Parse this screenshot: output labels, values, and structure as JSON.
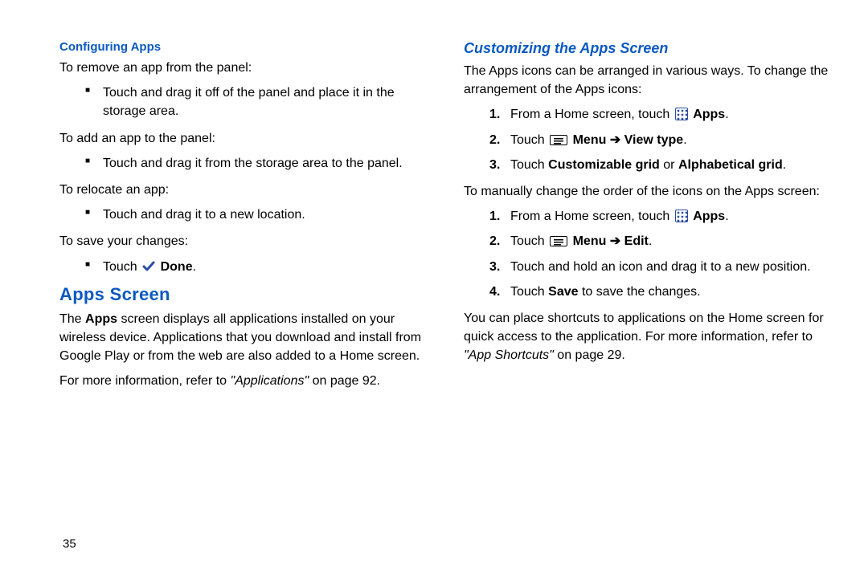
{
  "left": {
    "h_config": "Configuring Apps",
    "remove_intro": "To remove an app from the panel:",
    "remove_b1": "Touch and drag it off of the panel and place it in the storage area.",
    "add_intro": "To add an app to the panel:",
    "add_b1": "Touch and drag it from the storage area to the panel.",
    "relocate_intro": "To relocate an app:",
    "relocate_b1": "Touch and drag it to a new location.",
    "save_intro": "To save your changes:",
    "save_touch": "Touch ",
    "save_done": " Done",
    "h_apps": "Apps Screen",
    "apps_p1a": "The ",
    "apps_p1b": "Apps",
    "apps_p1c": " screen displays all applications installed on your wireless device. Applications that you download and install from Google Play or from the web are also added to a Home screen.",
    "apps_p2a": "For more information, refer to ",
    "apps_p2b": "\"Applications\"",
    "apps_p2c": " on page 92."
  },
  "right": {
    "h_custom": "Customizing the Apps Screen",
    "intro": "The Apps icons can be arranged in various ways. To change the arrangement of the Apps icons:",
    "s1_a": "From a Home screen, touch ",
    "s1_b": " Apps",
    "s1_c": ".",
    "s2_a": "Touch ",
    "s2_b": " Menu ➔ View type",
    "s2_c": ".",
    "s3_a": "Touch ",
    "s3_b": "Customizable grid",
    "s3_c": " or ",
    "s3_d": "Alphabetical grid",
    "s3_e": ".",
    "mid": "To manually change the order of the icons on the Apps screen:",
    "m1_a": "From a Home screen, touch ",
    "m1_b": " Apps",
    "m1_c": ".",
    "m2_a": "Touch ",
    "m2_b": " Menu ➔ Edit",
    "m2_c": ".",
    "m3": "Touch and hold an icon and drag it to a new position.",
    "m4_a": "Touch ",
    "m4_b": "Save",
    "m4_c": " to save the changes.",
    "out_a": "You can place shortcuts to applications on the Home screen for quick access to the application. For more information, refer to ",
    "out_b": "\"App Shortcuts\"",
    "out_c": " on page 29."
  },
  "pagenum": "35"
}
